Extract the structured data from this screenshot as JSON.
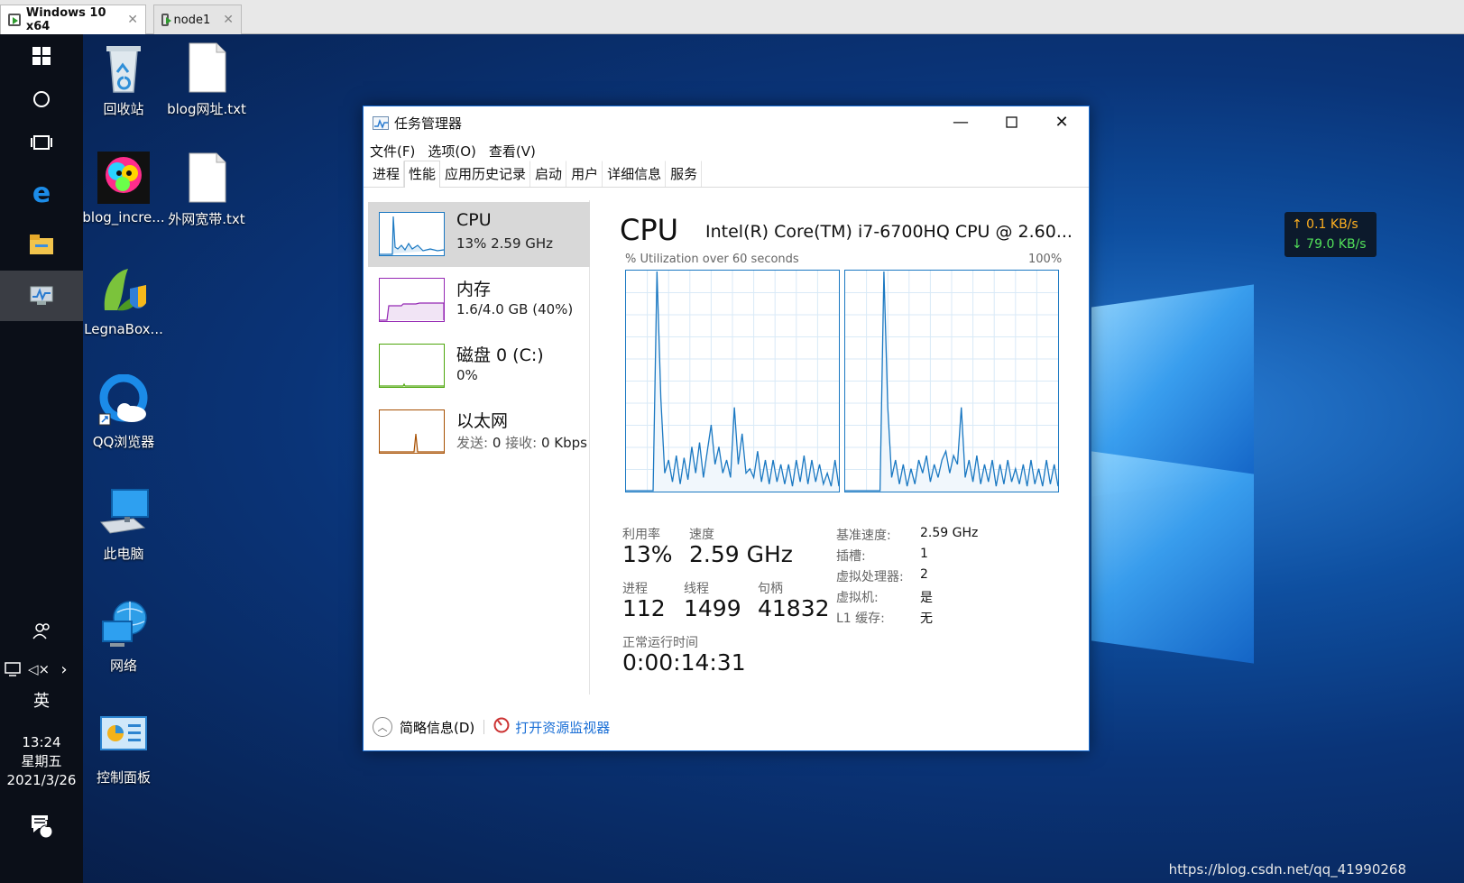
{
  "vm_tabs": [
    {
      "label": "Windows 10 x64",
      "active": true
    },
    {
      "label": "node1",
      "active": false
    }
  ],
  "taskbar": {
    "items": [
      {
        "name": "start-icon"
      },
      {
        "name": "search-circle-icon"
      },
      {
        "name": "task-view-icon"
      },
      {
        "name": "edge-icon"
      },
      {
        "name": "file-explorer-icon"
      },
      {
        "name": "task-manager-taskbar-icon"
      }
    ],
    "tray": {
      "ime": "英",
      "time": "13:24",
      "weekday": "星期五",
      "date": "2021/3/26",
      "notification_count": "1"
    }
  },
  "desktop_icons": [
    {
      "label": "回收站",
      "icon": "recycle-bin-icon"
    },
    {
      "label": "blog网址.txt",
      "icon": "text-file-icon"
    },
    {
      "label": "blog_incre...",
      "icon": "tiger-image-icon"
    },
    {
      "label": "外网宽带.txt",
      "icon": "text-file-icon"
    },
    {
      "label": "LegnaBox...",
      "icon": "legnabox-icon"
    },
    {
      "label": "QQ浏览器",
      "icon": "qq-browser-icon"
    },
    {
      "label": "此电脑",
      "icon": "this-pc-icon"
    },
    {
      "label": "网络",
      "icon": "network-icon"
    },
    {
      "label": "控制面板",
      "icon": "control-panel-icon"
    }
  ],
  "net_speed": {
    "up": "↑ 0.1 KB/s",
    "down": "↓ 79.0 KB/s"
  },
  "watermark": "https://blog.csdn.net/qq_41990268",
  "task_manager": {
    "title": "任务管理器",
    "menu": [
      "文件(F)",
      "选项(O)",
      "查看(V)"
    ],
    "tabs": [
      "进程",
      "性能",
      "应用历史记录",
      "启动",
      "用户",
      "详细信息",
      "服务"
    ],
    "selected_tab": "性能",
    "resources": [
      {
        "name": "CPU",
        "sub_a": "13%  2.59 GHz",
        "color": "#1a78c2"
      },
      {
        "name": "内存",
        "sub_a": "1.6/4.0 GB (40%)",
        "color": "#9528b4"
      },
      {
        "name": "磁盘 0 (C:)",
        "sub_a": "0%",
        "color": "#4da60c"
      },
      {
        "name": "以太网",
        "sub_a_muted": "发送:",
        "sub_a": " 0 ",
        "sub_b_muted": "接收:",
        "sub_b": " 0 Kbps",
        "color": "#a74f01"
      }
    ],
    "cpu": {
      "heading": "CPU",
      "model": "Intel(R) Core(TM) i7-6700HQ CPU @ 2.60...",
      "graph_caption_left": "% Utilization over 60 seconds",
      "graph_caption_right": "100%",
      "cores": [
        [
          0,
          0,
          0,
          0,
          0,
          0,
          0,
          0,
          100,
          42,
          8,
          14,
          4,
          16,
          3,
          15,
          5,
          20,
          8,
          22,
          6,
          18,
          30,
          12,
          20,
          8,
          14,
          6,
          38,
          12,
          26,
          8,
          10,
          6,
          18,
          4,
          14,
          3,
          14,
          4,
          12,
          3,
          12,
          2,
          14,
          4,
          16,
          3,
          14,
          4,
          12,
          3,
          8,
          2,
          14,
          2
        ],
        [
          0,
          0,
          0,
          0,
          0,
          0,
          0,
          0,
          0,
          0,
          100,
          38,
          6,
          14,
          3,
          12,
          2,
          10,
          3,
          14,
          8,
          16,
          4,
          12,
          6,
          14,
          18,
          8,
          16,
          12,
          38,
          6,
          14,
          4,
          16,
          3,
          12,
          4,
          14,
          2,
          12,
          3,
          14,
          4,
          10,
          3,
          12,
          2,
          14,
          3,
          10,
          2,
          14,
          3,
          12,
          2
        ]
      ],
      "stats": {
        "util_label": "利用率",
        "util_value": "13%",
        "speed_label": "速度",
        "speed_value": "2.59 GHz",
        "proc_label": "进程",
        "proc_value": "112",
        "thread_label": "线程",
        "thread_value": "1499",
        "handle_label": "句柄",
        "handle_value": "41832",
        "uptime_label": "正常运行时间",
        "uptime_value": "0:00:14:31"
      },
      "specs": [
        {
          "label": "基准速度:",
          "value": "2.59 GHz"
        },
        {
          "label": "插槽:",
          "value": "1"
        },
        {
          "label": "虚拟处理器:",
          "value": "2"
        },
        {
          "label": "虚拟机:",
          "value": "是"
        },
        {
          "label": "L1 缓存:",
          "value": "无"
        }
      ]
    },
    "footer": {
      "brief_label": "简略信息(D)",
      "monitor_label": "打开资源监视器"
    }
  }
}
